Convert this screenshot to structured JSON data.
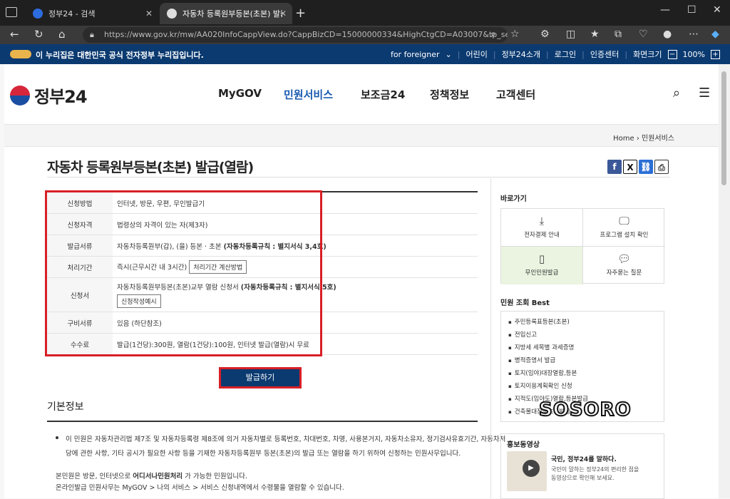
{
  "browser": {
    "tabs": [
      {
        "label": "정부24 - 검색"
      },
      {
        "label": "자동차 등록원부등본(초본) 발급(열람)"
      }
    ],
    "url": "https://www.gov.kr/mw/AA020InfoCappView.do?CappBizCD=15000000334&HighCtgCD=A03007&tp_seq=0..."
  },
  "gov_banner": {
    "message": "이 누리집은 대한민국 공식 전자정부 누리집입니다.",
    "foreigner": "for foreigner",
    "links": [
      "어린이",
      "정부24소개",
      "로그인",
      "인증센터",
      "화면크기"
    ],
    "zoom": "100%"
  },
  "header": {
    "brand": "정부24",
    "nav": [
      "MyGOV",
      "민원서비스",
      "보조금24",
      "정책정보",
      "고객센터"
    ]
  },
  "breadcrumb": {
    "home": "Home",
    "current": "민원서비스"
  },
  "page_title": "자동차 등록원부등본(초본) 발급(열람)",
  "info_table": [
    {
      "label": "신청방법",
      "value": "인터넷, 방문, 우편, 무인발급기"
    },
    {
      "label": "신청자격",
      "value": "법령상의 자격이 있는 자(제3자)"
    },
    {
      "label": "발급서류",
      "value": "자동차등록원부(갑), (을) 등본 · 초본 ",
      "bold": "(자동차등록규칙 : 별지서식 3,4호)"
    },
    {
      "label": "처리기간",
      "value": "즉시(근무시간 내 3시간)",
      "button": "처리기간 계산방법"
    },
    {
      "label": "신청서",
      "value": "자동차등록원부등본(초본)교부 열람 신청서 ",
      "bold": "(자동차등록규칙 : 별지서식 5호)",
      "button": "신청작성예시"
    },
    {
      "label": "구비서류",
      "value": "있음 (하단참조)"
    },
    {
      "label": "수수료",
      "value": "발급(1건당):300원, 열람(1건당):100원, 인터넷 발급(열람)시 무료"
    }
  ],
  "issue_button": "발급하기",
  "basic_info": {
    "title": "기본정보",
    "line1": "이 민원은 자동차관리법 제7조 및 자동차등록령 제8조에 의거 자동차별로 등록번호, 차대번호, 차명, 사용본거지, 자동차소유자, 정기검사유효기간, 자동차저",
    "line2": "당에 관한 사항, 기타 공시가 필요한 사항 등을 기재한 자동차등록원부 등본(초본)의 발급 또는 열람을 하기 위하여 신청하는 민원사무입니다.",
    "line3a": "본민원은 방문, 인터넷으로 ",
    "line3b": "어디서나민원처리",
    "line3c": " 가 가능한 민원입니다.",
    "line4": "온라인발급 민원사무는 MyGOV > 나의 서비스 > 서비스 신청내역에서 수령물을 열람할 수 있습니다."
  },
  "sidebar": {
    "quick_title": "바로가기",
    "quick": [
      "전자결제 안내",
      "프로그램 설치 확인",
      "무인민원발급",
      "자주묻는 질문"
    ],
    "best_title": "민원 조회 Best",
    "best": [
      "주민등록표등본(초본)",
      "전입신고",
      "지방세 세목별 과세증명",
      "병적증명서 발급",
      "토지(임야)대장열람,등본",
      "토지이용계획확인 신청",
      "지적도(임야도)열람,등본발급",
      "건축물대장등초본발급"
    ],
    "video_title": "홍보동영상",
    "video_heading": "국민, 정부24를 말하다.",
    "video_desc1": "국민이 말하는 정부24의 편리한 점을",
    "video_desc2": "동영상으로 확인해 보세요."
  },
  "watermark": "SOSORO"
}
